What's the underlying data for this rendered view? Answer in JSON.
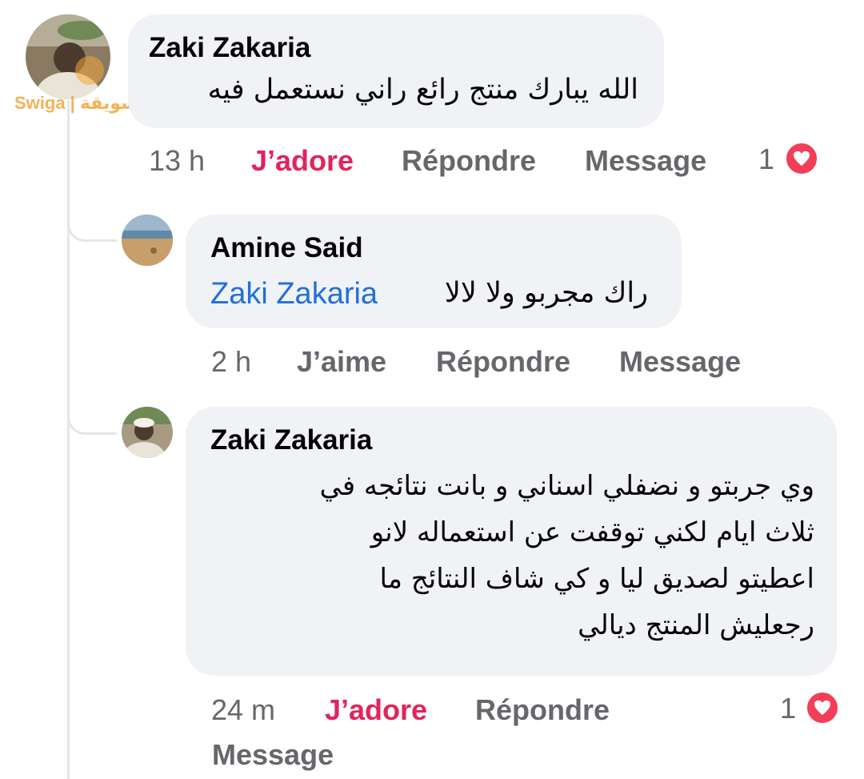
{
  "watermark": {
    "text": "Swiga | سويقة"
  },
  "comments": [
    {
      "author": "Zaki Zakaria",
      "text": "الله يبارك منتج رائع راني نستعمل فيه",
      "time": "13 h",
      "reaction_action": "J’adore",
      "reply_action": "Répondre",
      "message_action": "Message",
      "reaction_count": "1",
      "reaction_icon": "heart-icon"
    },
    {
      "author": "Amine Said",
      "mention": "Zaki Zakaria",
      "text": "راك مجربو ولا لالا",
      "time": "2 h",
      "reaction_action": "J’aime",
      "reply_action": "Répondre",
      "message_action": "Message"
    },
    {
      "author": "Zaki Zakaria",
      "lines": [
        "وي جربتو و نضفلي اسناني و بانت نتائجه في",
        "ثلاث ايام لكني توقفت عن استعماله لانو",
        "اعطيتو لصديق ليا و كي شاف النتائج ما",
        "رجعليش المنتج ديالي"
      ],
      "time": "24 m",
      "reaction_action": "J’adore",
      "reply_action": "Répondre",
      "message_action": "Message",
      "reaction_count": "1",
      "reaction_icon": "heart-icon"
    }
  ],
  "colors": {
    "bubble": "#f0f2f5",
    "loved": "#e0245e",
    "heart": "#f33e58",
    "mention": "#216fdb",
    "meta": "#65676b"
  }
}
